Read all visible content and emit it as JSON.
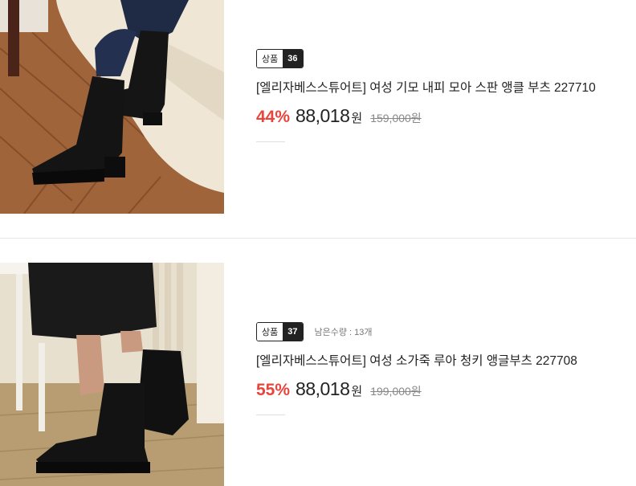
{
  "items": [
    {
      "badge_label": "상품",
      "badge_number": "36",
      "stock_text": "",
      "title": "[엘리자베스스튜어트] 여성 기모 내피 모아 스판 앵클 부츠 227710",
      "discount": "44%",
      "price": "88,018",
      "currency": "원",
      "original_price": "159,000원"
    },
    {
      "badge_label": "상품",
      "badge_number": "37",
      "stock_text": "남은수량 : 13개",
      "title": "[엘리자베스스튜어트] 여성 소가죽 루아 청키 앵글부츠 227708",
      "discount": "55%",
      "price": "88,018",
      "currency": "원",
      "original_price": "199,000원"
    }
  ],
  "colors": {
    "discount": "#e8453c",
    "badge_dark": "#222222",
    "divider": "#e6e6e6"
  }
}
